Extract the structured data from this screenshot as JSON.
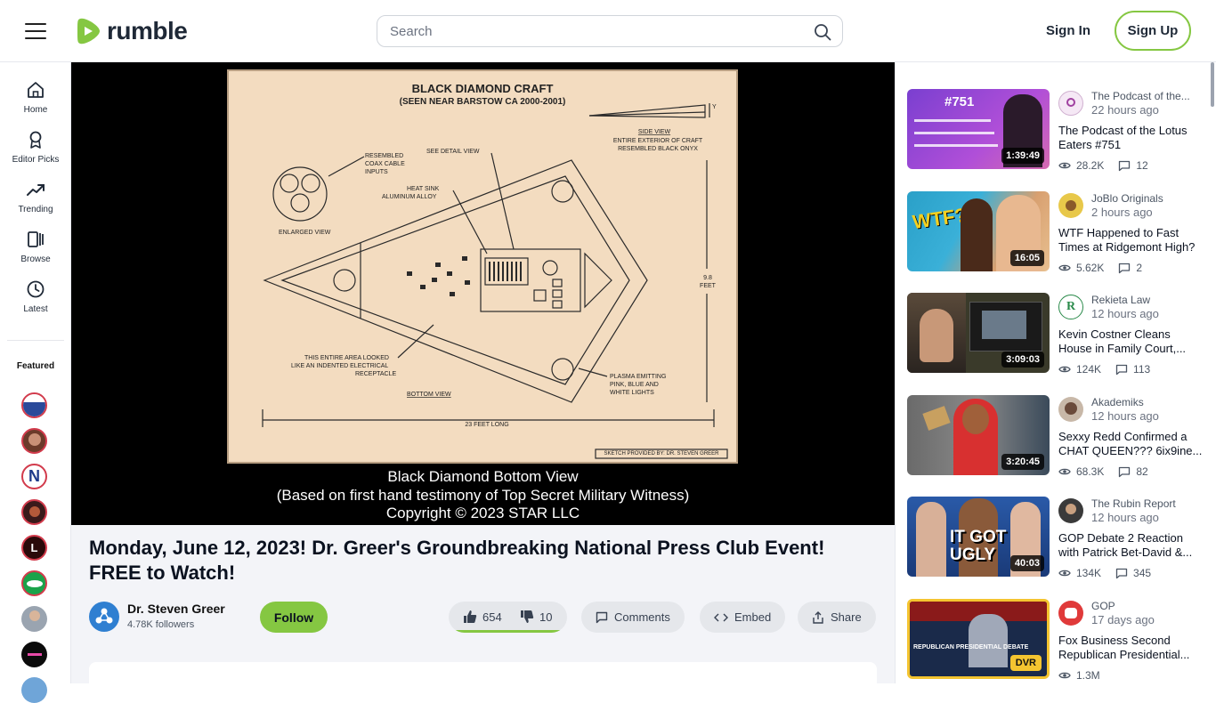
{
  "header": {
    "logo_text": "rumble",
    "search_placeholder": "Search",
    "signin_label": "Sign In",
    "signup_label": "Sign Up",
    "brand_color": "#85c742"
  },
  "nav": {
    "items": [
      {
        "label": "Home",
        "icon": "home-icon"
      },
      {
        "label": "Editor Picks",
        "icon": "ribbon-icon"
      },
      {
        "label": "Trending",
        "icon": "trending-icon"
      },
      {
        "label": "Browse",
        "icon": "browse-icon"
      },
      {
        "label": "Latest",
        "icon": "clock-icon"
      }
    ],
    "featured_label": "Featured"
  },
  "video": {
    "sketch": {
      "title": "BLACK DIAMOND CRAFT",
      "subtitle": "(SEEN NEAR BARSTOW CA 2000-2001)",
      "side_view": "SIDE VIEW",
      "exterior_note_1": "ENTIRE EXTERIOR OF CRAFT",
      "exterior_note_2": "RESEMBLED BLACK ONYX",
      "coax_1": "RESEMBLED",
      "coax_2": "COAX CABLE",
      "coax_3": "INPUTS",
      "detail": "SEE DETAIL VIEW",
      "heat_1": "HEAT SINK",
      "heat_2": "ALUMINUM ALLOY",
      "enlarged": "ENLARGED VIEW",
      "area_1": "THIS ENTIRE AREA LOOKED",
      "area_2": "LIKE AN INDENTED ELECTRICAL",
      "area_3": "RECEPTACLE",
      "bottom_view": "BOTTOM VIEW",
      "plasma_1": "PLASMA EMITTING",
      "plasma_2": "PINK, BLUE AND",
      "plasma_3": "WHITE LIGHTS",
      "height_1": "9.8",
      "height_2": "FEET",
      "length": "23 FEET LONG",
      "credit": "SKETCH PROVIDED BY: DR. STEVEN GREER",
      "y_marker": "Y"
    },
    "caption_1": "Black Diamond Bottom View",
    "caption_2": "(Based on first hand testimony of Top Secret Military Witness)",
    "caption_3": "Copyright © 2023 STAR LLC",
    "title": "Monday, June 12, 2023! Dr. Greer's Groundbreaking National Press Club Event! FREE to Watch!",
    "channel": "Dr. Steven Greer",
    "followers": "4.78K followers",
    "follow_label": "Follow",
    "likes": "654",
    "dislikes": "10",
    "like_ratio": 0.985,
    "comments_label": "Comments",
    "embed_label": "Embed",
    "share_label": "Share"
  },
  "recommended": [
    {
      "channel": "The Podcast of the...",
      "time": "22 hours ago",
      "title": "The Podcast of the Lotus Eaters #751",
      "duration": "1:39:49",
      "views": "28.2K",
      "comments": "12",
      "thumb_text": "#751"
    },
    {
      "channel": "JoBlo Originals",
      "time": "2 hours ago",
      "title": "WTF Happened to Fast Times at Ridgemont High?",
      "duration": "16:05",
      "views": "5.62K",
      "comments": "2",
      "thumb_text": "WTF?"
    },
    {
      "channel": "Rekieta Law",
      "time": "12 hours ago",
      "title": "Kevin Costner Cleans House in Family Court,...",
      "duration": "3:09:03",
      "views": "124K",
      "comments": "113",
      "thumb_text": ""
    },
    {
      "channel": "Akademiks",
      "time": "12 hours ago",
      "title": "Sexxy Redd Confirmed a CHAT QUEEN??? 6ix9ine...",
      "duration": "3:20:45",
      "views": "68.3K",
      "comments": "82",
      "thumb_text": ""
    },
    {
      "channel": "The Rubin Report",
      "time": "12 hours ago",
      "title": "GOP Debate 2 Reaction with Patrick Bet-David &...",
      "duration": "40:03",
      "views": "134K",
      "comments": "345",
      "thumb_text": "IT GOT UGLY"
    },
    {
      "channel": "GOP",
      "time": "17 days ago",
      "title": "Fox Business Second Republican Presidential...",
      "duration": "DVR",
      "views": "1.3M",
      "comments": "",
      "thumb_text": "REPUBLICAN PRESIDENTIAL DEBATE"
    }
  ]
}
